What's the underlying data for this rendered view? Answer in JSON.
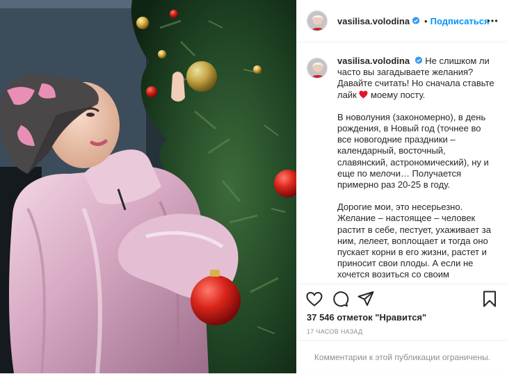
{
  "header": {
    "username": "vasilisa.volodina",
    "separator": "•",
    "follow_label": "Подписаться"
  },
  "caption": {
    "username": "vasilisa.volodina",
    "paragraph1_text": "Не слишком ли часто вы загадываете желания? Давайте считать! Но сначала ставьте лайк",
    "paragraph1_tail": "моему посту.",
    "paragraph2": "В новолуния (закономерно), в день рождения, в Новый год (точнее во все новогодние праздники – календарный, восточный, славянский, астрономический), ну и еще по мелочи… Получается примерно раз 20-25 в году.",
    "paragraph3": "Дорогие мои, это несерьезно. Желание – настоящее – человек растит в себе, пестует, ухаживает за ним, лелеет, воплощает и тогда оно пускает корни в его жизни, растет и приносит свои плоды. А если не хочется возиться со своим"
  },
  "stats": {
    "likes": "37 546 отметок \"Нравится\"",
    "time": "17 часов назад"
  },
  "comments_limited": "Комментарии к этой публикации ограничены.",
  "icons": {
    "more": "more-options-icon",
    "like": "heart-icon",
    "comment": "comment-icon",
    "share": "share-icon",
    "save": "bookmark-icon",
    "verified": "verified-badge-icon",
    "emoji": "red-heart-emoji-icon"
  },
  "colors": {
    "link": "#0095f6",
    "verified": "#3897f0",
    "text": "#262626",
    "secondary": "#8e8e8e",
    "border": "#efefef"
  }
}
